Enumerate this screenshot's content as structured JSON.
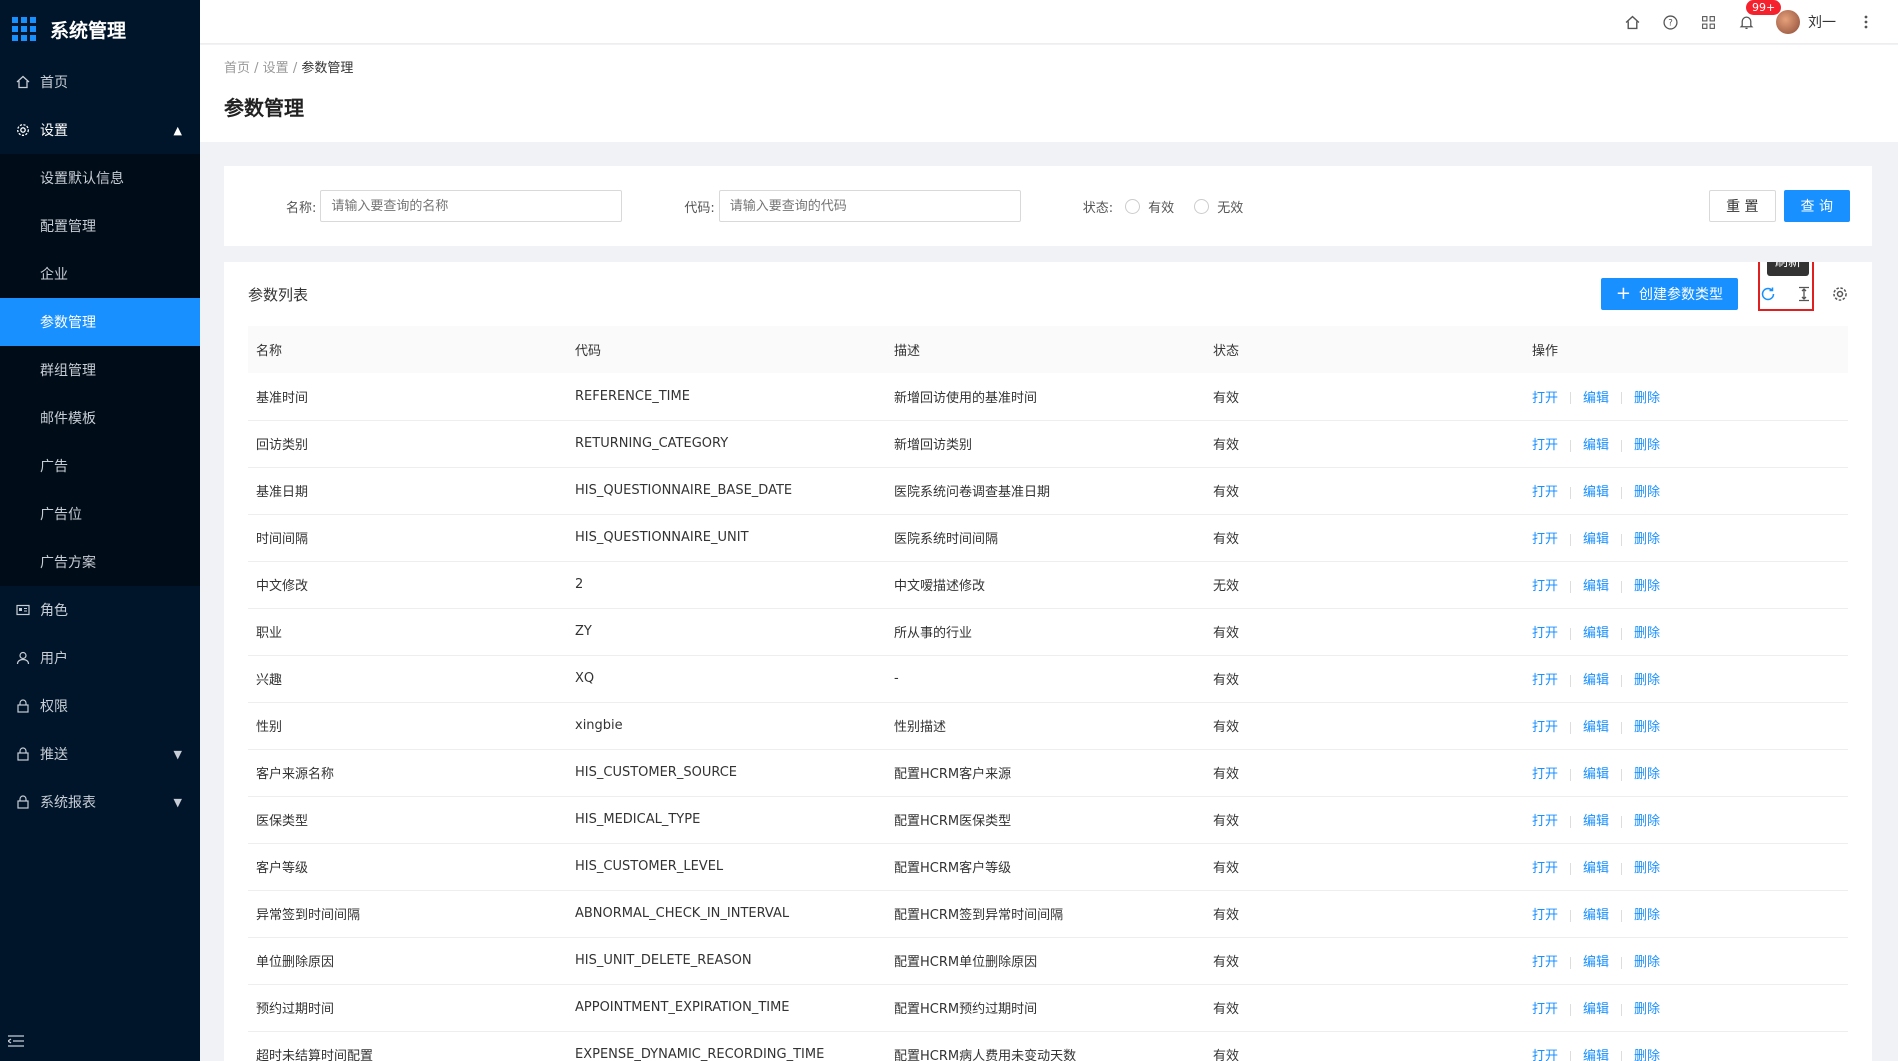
{
  "app_title": "系统管理",
  "sidebar": {
    "items": [
      {
        "label": "首页",
        "icon": "home-icon"
      },
      {
        "label": "设置",
        "icon": "gear-icon",
        "expanded": true
      },
      {
        "label": "角色",
        "icon": "id-card-icon"
      },
      {
        "label": "用户",
        "icon": "user-icon"
      },
      {
        "label": "权限",
        "icon": "lock-icon"
      },
      {
        "label": "推送",
        "icon": "lock-icon"
      },
      {
        "label": "系统报表",
        "icon": "lock-icon"
      }
    ],
    "submenu": [
      "设置默认信息",
      "配置管理",
      "企业",
      "参数管理",
      "群组管理",
      "邮件模板",
      "广告",
      "广告位",
      "广告方案"
    ],
    "active_submenu": "参数管理"
  },
  "topbar": {
    "badge": "99+",
    "user_name": "刘一"
  },
  "breadcrumb": [
    "首页",
    "设置",
    "参数管理"
  ],
  "page_title": "参数管理",
  "search": {
    "name_label": "名称:",
    "name_placeholder": "请输入要查询的名称",
    "code_label": "代码:",
    "code_placeholder": "请输入要查询的代码",
    "status_label": "状态:",
    "status_valid": "有效",
    "status_invalid": "无效",
    "reset_label": "重 置",
    "query_label": "查 询"
  },
  "table": {
    "title": "参数列表",
    "create_label": "创建参数类型",
    "tooltip": "刷新",
    "columns": [
      "名称",
      "代码",
      "描述",
      "状态",
      "操作"
    ],
    "actions": [
      "打开",
      "编辑",
      "删除"
    ],
    "rows": [
      [
        "基准时间",
        "REFERENCE_TIME",
        "新增回访使用的基准时间",
        "有效"
      ],
      [
        "回访类别",
        "RETURNING_CATEGORY",
        "新增回访类别",
        "有效"
      ],
      [
        "基准日期",
        "HIS_QUESTIONNAIRE_BASE_DATE",
        "医院系统问卷调查基准日期",
        "有效"
      ],
      [
        "时间间隔",
        "HIS_QUESTIONNAIRE_UNIT",
        "医院系统时间间隔",
        "有效"
      ],
      [
        "中文修改",
        "2",
        "中文嗳描述修改",
        "无效"
      ],
      [
        "职业",
        "ZY",
        "所从事的行业",
        "有效"
      ],
      [
        "兴趣",
        "XQ",
        "-",
        "有效"
      ],
      [
        "性别",
        "xingbie",
        "性别描述",
        "有效"
      ],
      [
        "客户来源名称",
        "HIS_CUSTOMER_SOURCE",
        "配置HCRM客户来源",
        "有效"
      ],
      [
        "医保类型",
        "HIS_MEDICAL_TYPE",
        "配置HCRM医保类型",
        "有效"
      ],
      [
        "客户等级",
        "HIS_CUSTOMER_LEVEL",
        "配置HCRM客户等级",
        "有效"
      ],
      [
        "异常签到时间间隔",
        "ABNORMAL_CHECK_IN_INTERVAL",
        "配置HCRM签到异常时间间隔",
        "有效"
      ],
      [
        "单位删除原因",
        "HIS_UNIT_DELETE_REASON",
        "配置HCRM单位删除原因",
        "有效"
      ],
      [
        "预约过期时间",
        "APPOINTMENT_EXPIRATION_TIME",
        "配置HCRM预约过期时间",
        "有效"
      ],
      [
        "超时未结算时间配置",
        "EXPENSE_DYNAMIC_RECORDING_TIME",
        "配置HCRM病人费用未变动天数",
        "有效"
      ]
    ]
  }
}
